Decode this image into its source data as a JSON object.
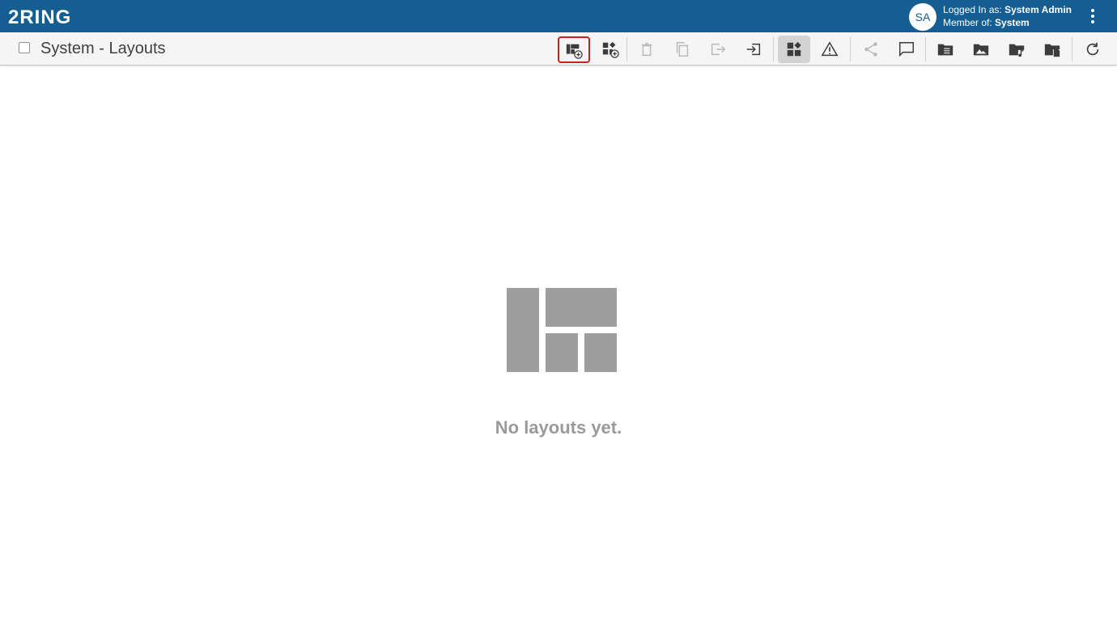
{
  "header": {
    "logo_text": "2RING",
    "avatar_initials": "SA",
    "logged_in_label": "Logged In as:",
    "logged_in_user": "System Admin",
    "member_label": "Member of:",
    "member_group": "System",
    "brand_color": "#155e92"
  },
  "toolbar": {
    "title": "System - Layouts",
    "buttons": [
      {
        "name": "add-layout",
        "icon": "layout-add-icon",
        "state": "highlighted"
      },
      {
        "name": "add-widget-layout",
        "icon": "widgets-add-icon",
        "state": "enabled"
      },
      {
        "name": "delete",
        "icon": "trash-icon",
        "state": "disabled"
      },
      {
        "name": "copy",
        "icon": "copy-icon",
        "state": "disabled"
      },
      {
        "name": "export",
        "icon": "export-icon",
        "state": "disabled"
      },
      {
        "name": "import",
        "icon": "import-icon",
        "state": "enabled"
      },
      {
        "name": "widgets-view",
        "icon": "widgets-icon",
        "state": "active"
      },
      {
        "name": "warnings",
        "icon": "warning-icon",
        "state": "enabled"
      },
      {
        "name": "share",
        "icon": "share-icon",
        "state": "disabled"
      },
      {
        "name": "comments",
        "icon": "comment-icon",
        "state": "enabled"
      },
      {
        "name": "folder-list",
        "icon": "folder-list-icon",
        "state": "enabled"
      },
      {
        "name": "images",
        "icon": "image-icon",
        "state": "enabled"
      },
      {
        "name": "music-folder",
        "icon": "folder-music-icon",
        "state": "enabled"
      },
      {
        "name": "folder-files",
        "icon": "folder-file-icon",
        "state": "enabled"
      },
      {
        "name": "refresh",
        "icon": "refresh-icon",
        "state": "enabled"
      }
    ]
  },
  "main": {
    "empty_message": "No layouts yet.",
    "empty_icon": "layout-placeholder-icon"
  }
}
